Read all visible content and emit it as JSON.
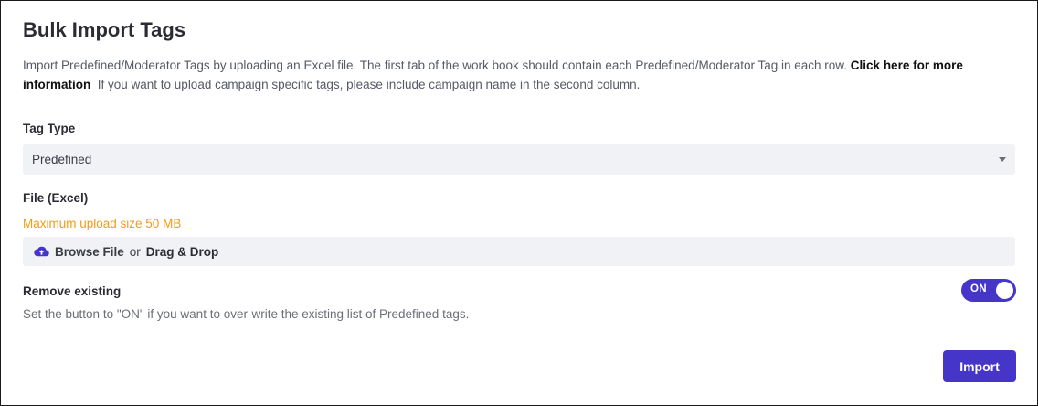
{
  "header": {
    "title": "Bulk Import Tags"
  },
  "description": {
    "text_before_link": "Import Predefined/Moderator Tags by uploading an Excel file. The first tab of the work book should contain each Predefined/Moderator Tag in each row. ",
    "link_text": "Click here for more information",
    "text_after_link": "  If you want to upload campaign specific tags, please include campaign name in the second column."
  },
  "tag_type": {
    "label": "Tag Type",
    "selected_value": "Predefined"
  },
  "file": {
    "label": "File (Excel)",
    "max_size_hint": "Maximum upload size 50 MB",
    "browse_label": "Browse File",
    "or_text": "or",
    "drag_label": "Drag & Drop"
  },
  "remove_existing": {
    "label": "Remove existing",
    "toggle_text": "ON",
    "toggle_on": true,
    "helper_text": "Set the button to \"ON\" if you want to over-write the existing list of Predefined tags."
  },
  "actions": {
    "import_label": "Import"
  },
  "colors": {
    "accent": "#4535c8",
    "warning_text": "#f39c12",
    "field_background": "#f1f2f5"
  },
  "icons": {
    "upload": "cloud-upload-icon",
    "dropdown": "caret-down-icon"
  }
}
